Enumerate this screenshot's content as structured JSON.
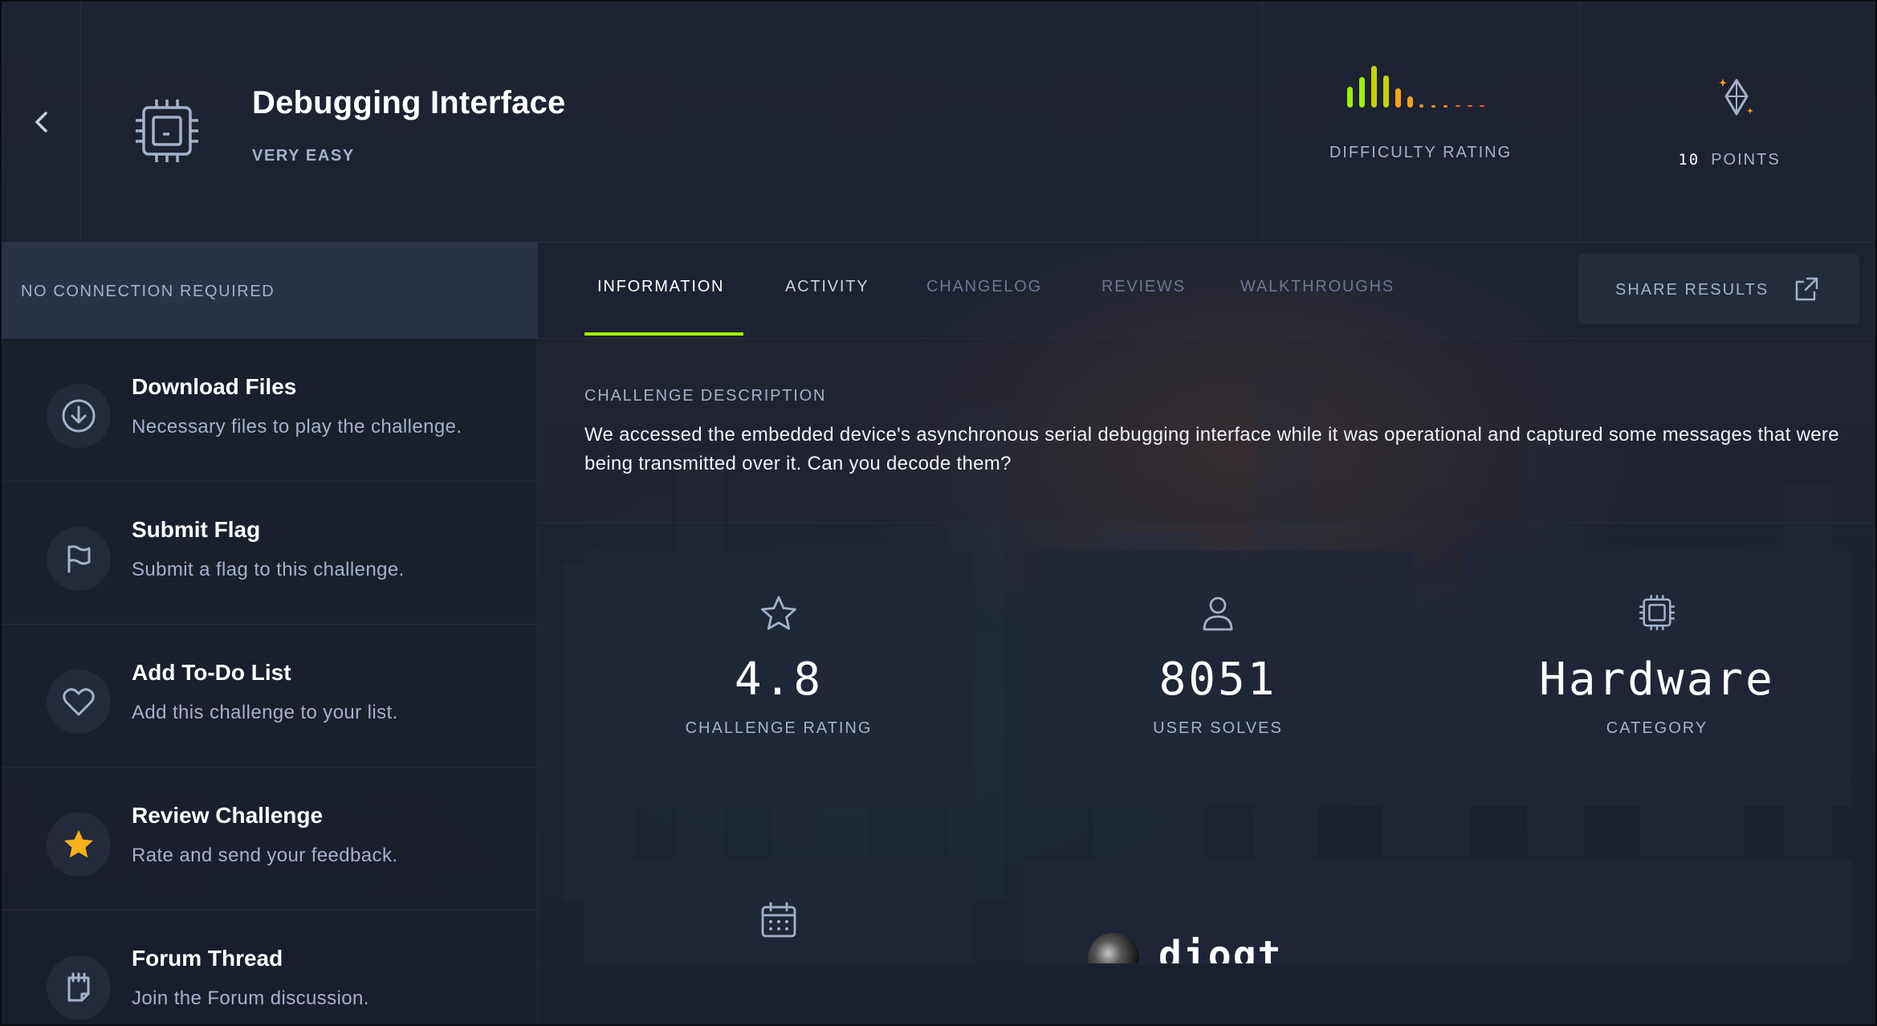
{
  "header": {
    "title": "Debugging Interface",
    "difficulty_level": "VERY EASY",
    "difficulty_label": "DIFFICULTY RATING",
    "points_value": "10",
    "points_label": "POINTS",
    "difficulty_colors": [
      "#9fef00",
      "#c4d400",
      "#f7a21b",
      "#f78e1b"
    ]
  },
  "sidebar": {
    "connection": "NO CONNECTION REQUIRED",
    "actions": [
      {
        "title": "Download Files",
        "desc": "Necessary files to play the challenge.",
        "icon": "download-icon"
      },
      {
        "title": "Submit Flag",
        "desc": "Submit a flag to this challenge.",
        "icon": "flag-icon"
      },
      {
        "title": "Add To-Do List",
        "desc": "Add this challenge to your list.",
        "icon": "heart-icon"
      },
      {
        "title": "Review Challenge",
        "desc": "Rate and send your feedback.",
        "icon": "star-icon"
      },
      {
        "title": "Forum Thread",
        "desc": "Join the Forum discussion.",
        "icon": "notebook-icon"
      }
    ]
  },
  "tabs": {
    "items": [
      "INFORMATION",
      "ACTIVITY",
      "CHANGELOG",
      "REVIEWS",
      "WALKTHROUGHS"
    ],
    "active": "INFORMATION",
    "share_label": "SHARE RESULTS",
    "accent": "#9fef00"
  },
  "description": {
    "heading": "CHALLENGE DESCRIPTION",
    "text": "We accessed the embedded device's asynchronous serial debugging interface while it was operational and captured some messages that were being transmitted over it. Can you decode them?"
  },
  "stats": [
    {
      "value": "4.8",
      "label": "CHALLENGE RATING",
      "icon": "star-outline-icon"
    },
    {
      "value": "8051",
      "label": "USER SOLVES",
      "icon": "user-icon"
    },
    {
      "value": "Hardware",
      "label": "CATEGORY",
      "icon": "chip-icon"
    }
  ],
  "lower_cards": {
    "creator_name": "diogt",
    "calendar_icon": "calendar-icon"
  }
}
